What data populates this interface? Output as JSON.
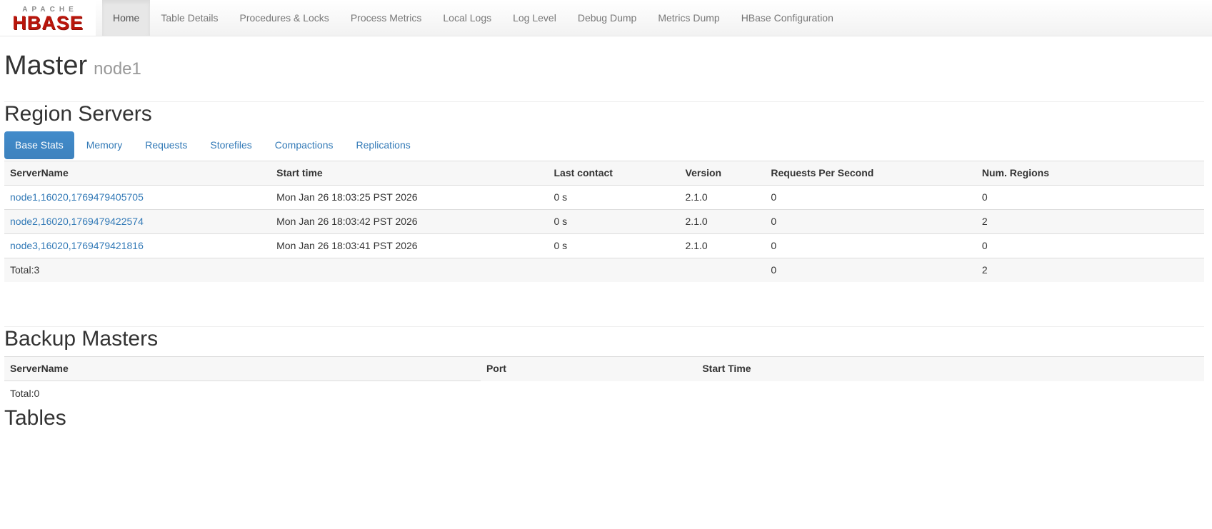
{
  "brand": {
    "line1": "APACHE",
    "line2": "HBASE"
  },
  "nav": {
    "items": [
      {
        "label": "Home",
        "active": true
      },
      {
        "label": "Table Details",
        "active": false
      },
      {
        "label": "Procedures & Locks",
        "active": false
      },
      {
        "label": "Process Metrics",
        "active": false
      },
      {
        "label": "Local Logs",
        "active": false
      },
      {
        "label": "Log Level",
        "active": false
      },
      {
        "label": "Debug Dump",
        "active": false
      },
      {
        "label": "Metrics Dump",
        "active": false
      },
      {
        "label": "HBase Configuration",
        "active": false
      }
    ]
  },
  "page": {
    "title": "Master",
    "subtitle": "node1"
  },
  "region_servers": {
    "heading": "Region Servers",
    "tabs": [
      {
        "label": "Base Stats",
        "active": true
      },
      {
        "label": "Memory",
        "active": false
      },
      {
        "label": "Requests",
        "active": false
      },
      {
        "label": "Storefiles",
        "active": false
      },
      {
        "label": "Compactions",
        "active": false
      },
      {
        "label": "Replications",
        "active": false
      }
    ],
    "table": {
      "columns": [
        "ServerName",
        "Start time",
        "Last contact",
        "Version",
        "Requests Per Second",
        "Num. Regions"
      ],
      "rows": [
        {
          "server": "node1,16020,1769479405705",
          "start_time": "Mon Jan 26 18:03:25 PST 2026",
          "last_contact": "0 s",
          "version": "2.1.0",
          "rps": "0",
          "regions": "0"
        },
        {
          "server": "node2,16020,1769479422574",
          "start_time": "Mon Jan 26 18:03:42 PST 2026",
          "last_contact": "0 s",
          "version": "2.1.0",
          "rps": "0",
          "regions": "2"
        },
        {
          "server": "node3,16020,1769479421816",
          "start_time": "Mon Jan 26 18:03:41 PST 2026",
          "last_contact": "0 s",
          "version": "2.1.0",
          "rps": "0",
          "regions": "0"
        }
      ],
      "total": {
        "label": "Total:3",
        "rps": "0",
        "regions": "2"
      }
    }
  },
  "backup_masters": {
    "heading": "Backup Masters",
    "table": {
      "columns": [
        "ServerName",
        "Port",
        "Start Time"
      ],
      "total": "Total:0"
    }
  },
  "tables_section": {
    "heading": "Tables"
  },
  "colors": {
    "accent": "#428bca",
    "link": "#337ab7",
    "brand_red": "#ba160c",
    "navbar_border": "#e7e7e7"
  }
}
